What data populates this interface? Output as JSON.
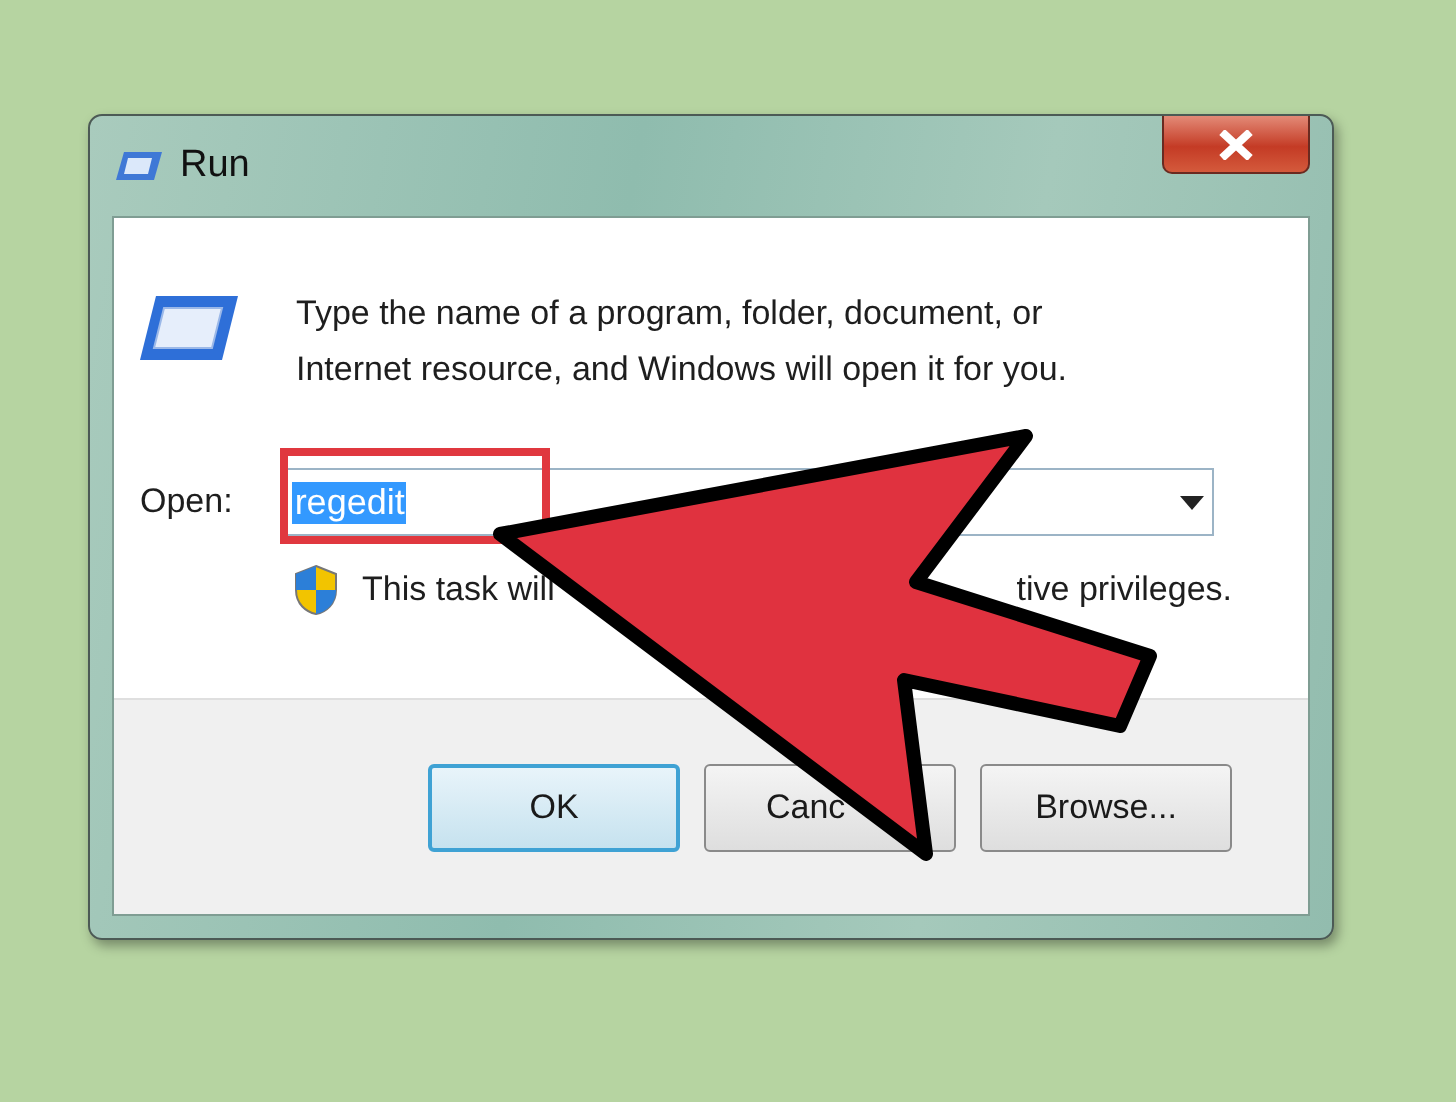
{
  "window": {
    "title": "Run"
  },
  "description": "Type the name of a program, folder, document, or Internet resource, and Windows will open it for you.",
  "open_field": {
    "label": "Open:",
    "value": "regedit",
    "value_selected": true
  },
  "admin_note": [
    "This task will",
    "tive privileges."
  ],
  "buttons": [
    {
      "label": "OK",
      "default": true
    },
    {
      "label": "Canc",
      "default": false
    },
    {
      "label": "Browse...",
      "default": false
    }
  ]
}
